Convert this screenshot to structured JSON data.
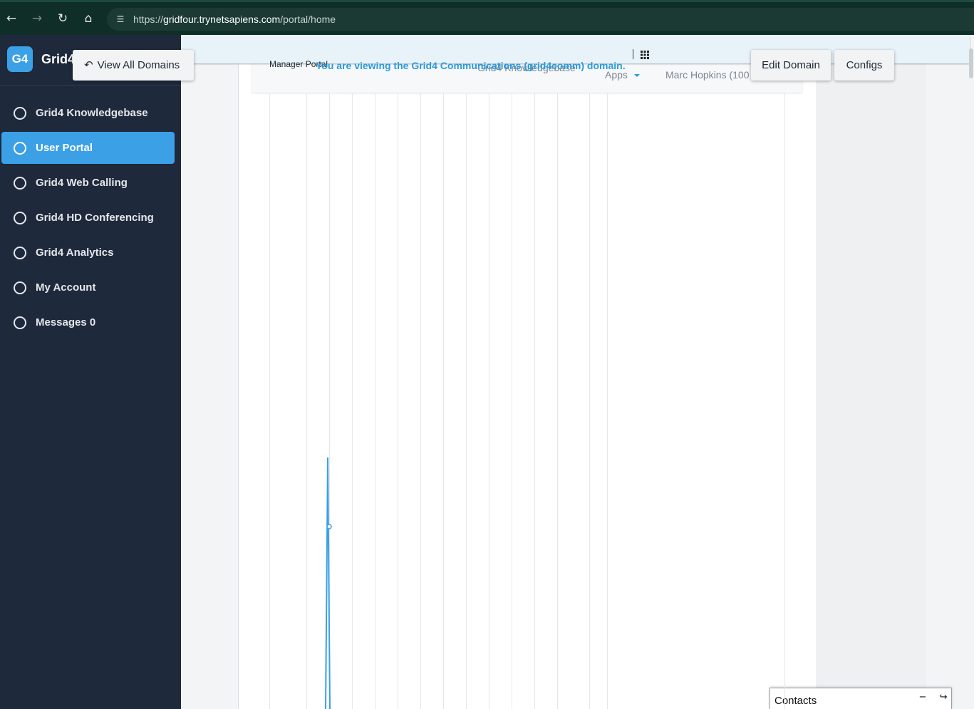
{
  "browser": {
    "url_scheme": "https://",
    "url_host": "gridfour.trynetsapiens.com",
    "url_path": "/portal/home"
  },
  "sidebar": {
    "logo_text": "G4",
    "brand_name": "Grid4",
    "items": [
      {
        "label": "Grid4 Knowledgebase",
        "active": false
      },
      {
        "label": "User Portal",
        "active": true
      },
      {
        "label": "Grid4 Web Calling",
        "active": false
      },
      {
        "label": "Grid4 HD Conferencing",
        "active": false
      },
      {
        "label": "Grid4 Analytics",
        "active": false
      },
      {
        "label": "My Account",
        "active": false
      },
      {
        "label": "Messages 0",
        "active": false
      }
    ]
  },
  "actions": {
    "view_all_domains": "View All Domains",
    "edit_domain": "Edit Domain",
    "configs": "Configs"
  },
  "banner": {
    "text": "You are viewing the Grid4 Communications (grid4comm) domain."
  },
  "topnav": {
    "manager_portal": "Manager Portal",
    "knowledgebase": "Grid4 Knowledgebase",
    "apps": "Apps",
    "user": "Marc Hopkins (100"
  },
  "dock": {
    "title": "Contacts"
  },
  "colors": {
    "accent": "#3ba0e6",
    "sidebar_bg": "#1e293b",
    "banner_text": "#2a9bdc",
    "browser_bar": "#0f2e28"
  }
}
